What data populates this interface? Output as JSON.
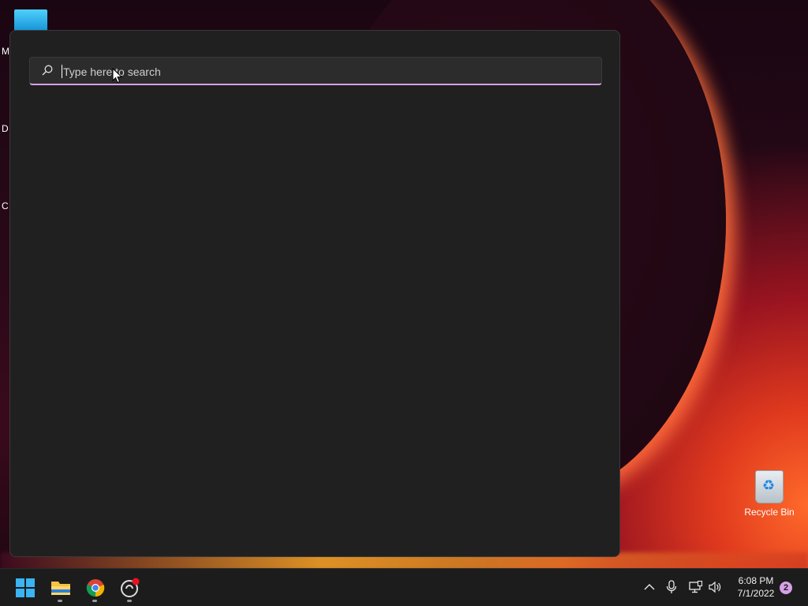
{
  "desktop": {
    "edge_letters": [
      "M",
      "D",
      "C"
    ],
    "recycle_bin_label": "Recycle Bin"
  },
  "search": {
    "placeholder": "Type here to search",
    "value": ""
  },
  "taskbar": {
    "apps": [
      {
        "name": "start",
        "icon": "windows-logo-icon"
      },
      {
        "name": "file-explorer",
        "icon": "folder-icon"
      },
      {
        "name": "chrome",
        "icon": "chrome-icon"
      },
      {
        "name": "app",
        "icon": "app-icon"
      }
    ],
    "clock_time": "6:08 PM",
    "clock_date": "7/1/2022",
    "notification_count": "2"
  },
  "colors": {
    "accent": "#d7a0e6",
    "panel_bg": "#202020",
    "taskbar_bg": "#1c1c1c"
  }
}
